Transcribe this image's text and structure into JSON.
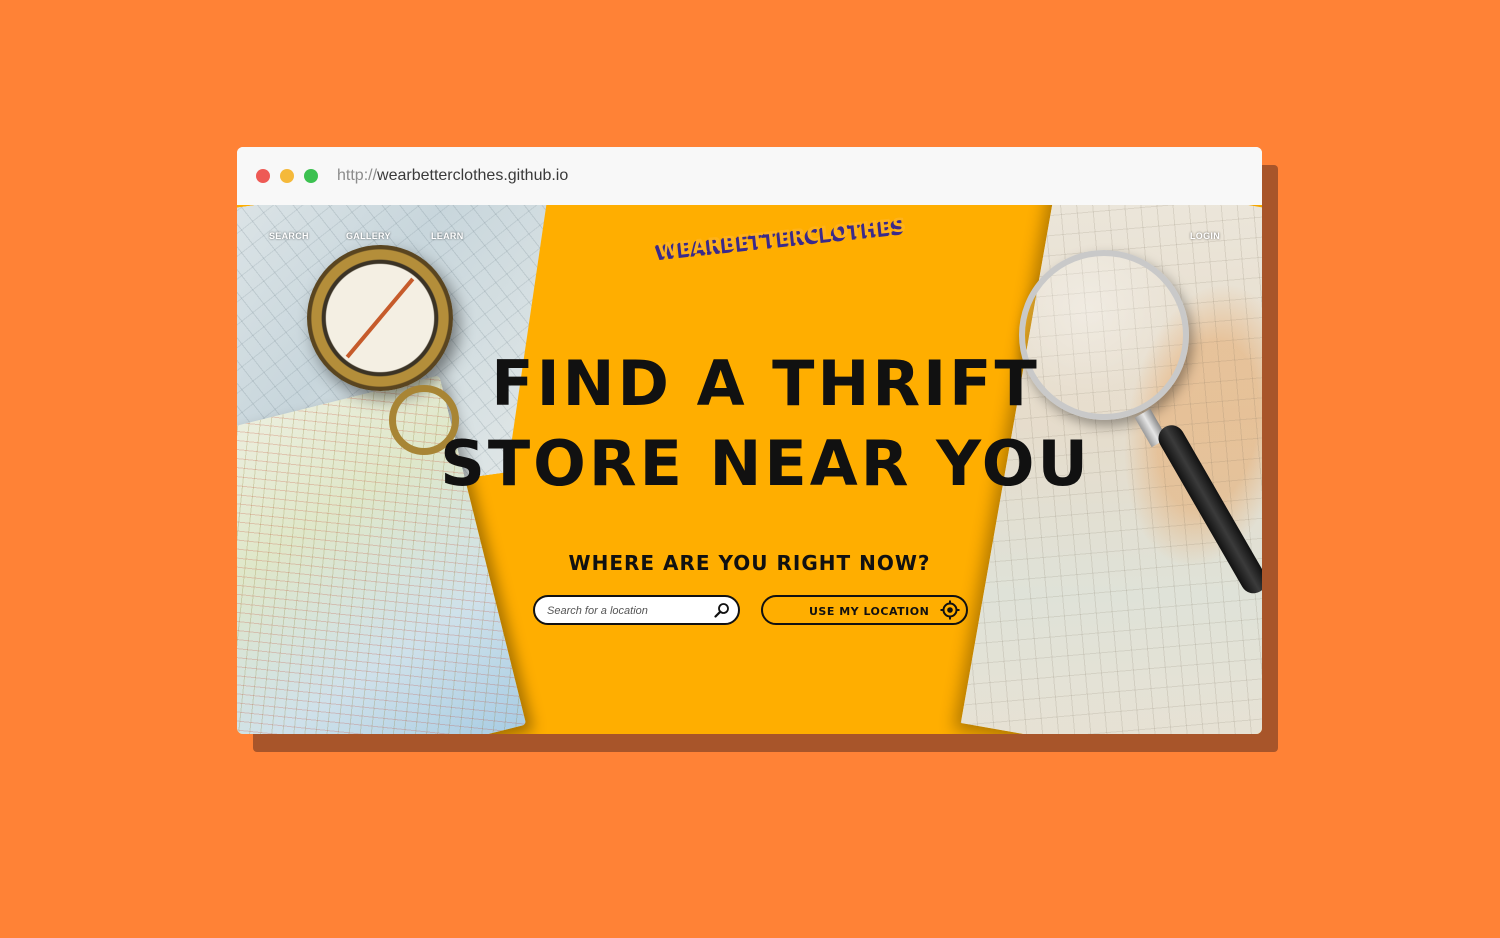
{
  "browser": {
    "url_protocol": "http://",
    "url_host": "wearbetterclothes.github.io"
  },
  "nav": {
    "items": [
      {
        "label": "SEARCH"
      },
      {
        "label": "GALLERY"
      },
      {
        "label": "LEARN"
      }
    ],
    "login_label": "LOGIN"
  },
  "brand": {
    "logo_text": "WEARBETTERCLOTHES"
  },
  "hero": {
    "line1": "FIND A THRIFT",
    "line2": "STORE NEAR YOU",
    "prompt": "WHERE ARE YOU RIGHT NOW?"
  },
  "search": {
    "placeholder": "Search for a location",
    "value": "",
    "icon": "search-icon"
  },
  "location_button": {
    "label": "USE MY LOCATION",
    "icon": "crosshair-icon"
  },
  "colors": {
    "background": "#ff8236",
    "page_accent": "#ffae00",
    "shadow": "#a8552a",
    "text": "#111111"
  }
}
